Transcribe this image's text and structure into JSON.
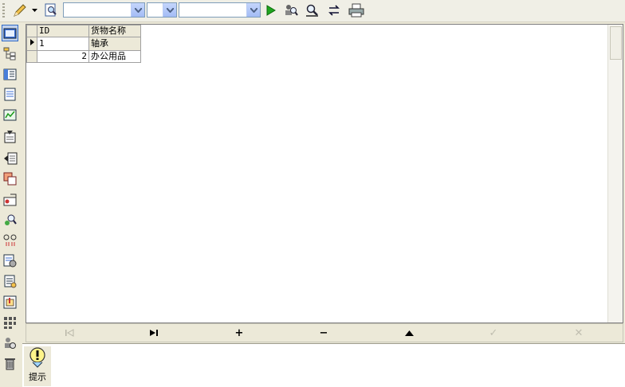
{
  "toolbar": {
    "combo1_value": "",
    "combo2_value": "",
    "combo3_value": ""
  },
  "grid": {
    "columns": [
      "ID",
      "货物名称"
    ],
    "rows": [
      {
        "id": "1",
        "name": "轴承"
      },
      {
        "id": "2",
        "name": "办公用品"
      }
    ]
  },
  "navigator": {
    "first": "⏮",
    "last": "▶|",
    "add": "+",
    "delete": "−",
    "up": "▲",
    "post": "✓",
    "cancel": "✕"
  },
  "hint": {
    "label": "提示"
  },
  "colors": {
    "accent": "#316ac5",
    "toolbar_bg": "#f0efe6",
    "window_bg": "#ece9d8"
  }
}
